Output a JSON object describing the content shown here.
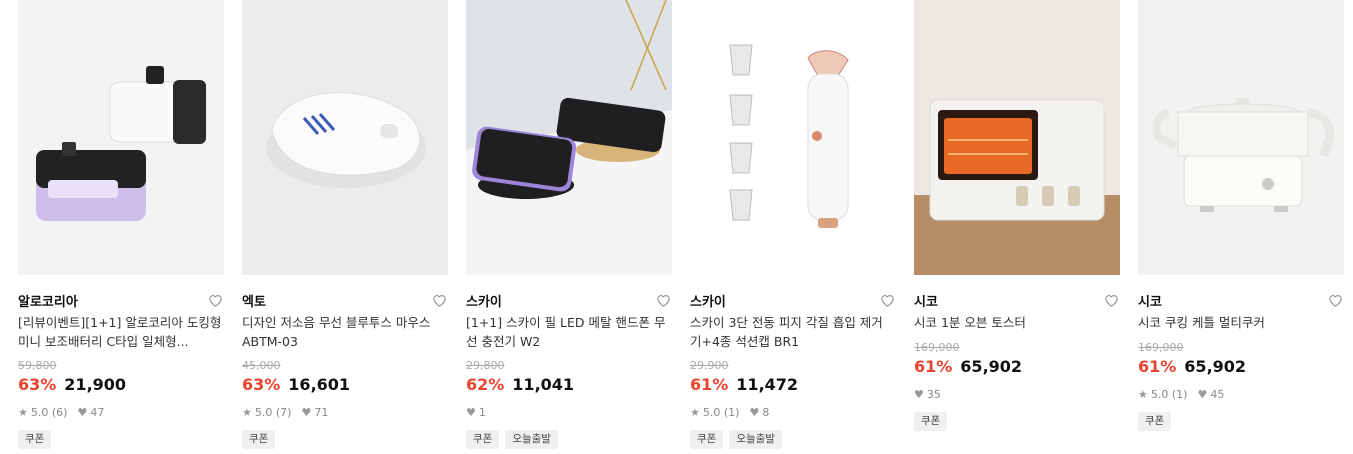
{
  "products": [
    {
      "brand": "알로코리아",
      "title": "[리뷰이벤트][1+1] 알로코리아 도킹형 미니 보조배터리 C타입 일체형...",
      "original_price": "59,800",
      "discount": "63%",
      "price": "21,900",
      "rating": "5.0 (6)",
      "likes": "47",
      "tags": [
        "쿠폰"
      ],
      "image": "power-bank-image"
    },
    {
      "brand": "엑토",
      "title": "디자인 저소음 무선 블루투스 마우스 ABTM-03",
      "original_price": "45,000",
      "discount": "63%",
      "price": "16,601",
      "rating": "5.0 (7)",
      "likes": "71",
      "tags": [
        "쿠폰"
      ],
      "image": "wireless-mouse-image"
    },
    {
      "brand": "스카이",
      "title": "[1+1] 스카이 필 LED 메탈 핸드폰 무선 충전기 W2",
      "original_price": "29,800",
      "discount": "62%",
      "price": "11,041",
      "rating": "",
      "likes": "1",
      "tags": [
        "쿠폰",
        "오늘출발"
      ],
      "image": "wireless-charger-image"
    },
    {
      "brand": "스카이",
      "title": "스카이 3단 전동 피지 각질 흡입 제거기+4종 석션캡 BR1",
      "original_price": "29,900",
      "discount": "61%",
      "price": "11,472",
      "rating": "5.0 (1)",
      "likes": "8",
      "tags": [
        "쿠폰",
        "오늘출발"
      ],
      "image": "pore-vacuum-image"
    },
    {
      "brand": "시코",
      "title": "시코 1분 오븐 토스터",
      "original_price": "169,000",
      "discount": "61%",
      "price": "65,902",
      "rating": "",
      "likes": "35",
      "tags": [
        "쿠폰"
      ],
      "image": "oven-toaster-image"
    },
    {
      "brand": "시코",
      "title": "시코 쿠킹 케틀 멀티쿠커",
      "original_price": "169,000",
      "discount": "61%",
      "price": "65,902",
      "rating": "5.0 (1)",
      "likes": "45",
      "tags": [
        "쿠폰"
      ],
      "image": "multi-cooker-image"
    }
  ],
  "colors": {
    "discount": "#e8442e",
    "price": "#111111",
    "muted": "#888888",
    "tag_bg": "#f0f0f0"
  },
  "icons": {
    "heart": "heart-outline-icon",
    "star": "star-icon",
    "like": "heart-filled-icon"
  }
}
